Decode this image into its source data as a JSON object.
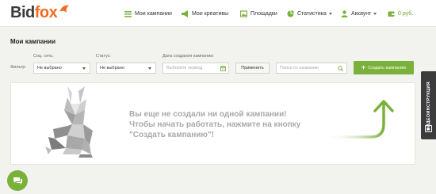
{
  "header": {
    "logo_part1": "Bid",
    "logo_part2": "fox",
    "nav": [
      {
        "label": "Мои кампании",
        "icon": "list-icon"
      },
      {
        "label": "Мои креативы",
        "icon": "megaphone-icon"
      },
      {
        "label": "Площадки",
        "icon": "image-icon"
      },
      {
        "label": "Статистика",
        "icon": "chart-icon"
      },
      {
        "label": "Аккаунт",
        "icon": "user-icon"
      }
    ],
    "balance": "0 руб."
  },
  "page": {
    "title": "Мои кампании"
  },
  "filters": {
    "label": "Фильтр:",
    "social_label": "Соц. сеть:",
    "social_value": "Не выбрано",
    "status_label": "Статус:",
    "status_value": "Не выбрано",
    "date_label": "Дата создания кампании:",
    "date_placeholder": "Выберите период",
    "apply_label": "Применить",
    "search_placeholder": "Поиск по названию",
    "create_label": "Создать кампанию"
  },
  "empty_state": {
    "message": "Вы еще не создали ни одной кампании! Чтобы начать работать, нажмите на кнопку \"Создать кампанию\"!"
  },
  "side_tab": {
    "label": "ВИДЕОИНСТРУКЦИЯ"
  },
  "colors": {
    "accent": "#79b13a",
    "brand_orange": "#f26b1d",
    "dark": "#3c3c3c"
  }
}
